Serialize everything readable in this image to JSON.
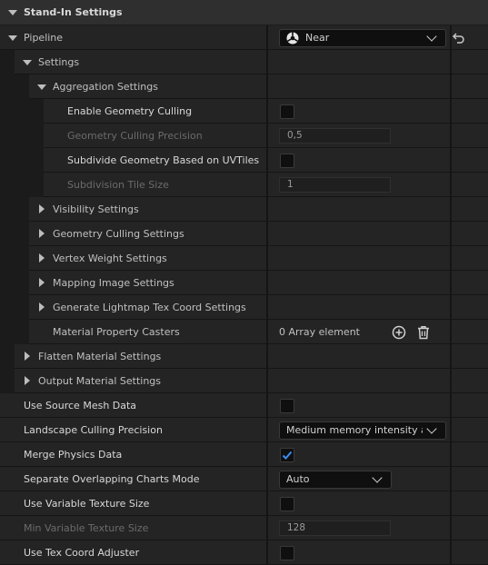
{
  "panel": {
    "title": "Stand-In Settings",
    "pipeline": {
      "label": "Pipeline",
      "value": "Near"
    },
    "settings_label": "Settings",
    "aggregation": {
      "label": "Aggregation Settings",
      "enable_geometry_culling": {
        "label": "Enable Geometry Culling",
        "checked": false
      },
      "geometry_culling_precision": {
        "label": "Geometry Culling Precision",
        "value": "0,5"
      },
      "subdivide_geometry": {
        "label": "Subdivide Geometry Based on UVTiles",
        "checked": false
      },
      "subdivision_tile_size": {
        "label": "Subdivision Tile Size",
        "value": "1"
      }
    },
    "collapsed_groups": [
      "Visibility Settings",
      "Geometry Culling Settings",
      "Vertex Weight Settings",
      "Mapping Image Settings",
      "Generate Lightmap Tex Coord Settings"
    ],
    "material_property_casters": {
      "label": "Material Property Casters",
      "value": "0 Array element"
    },
    "flatten_material": "Flatten Material Settings",
    "output_material": "Output Material Settings",
    "use_source_mesh_data": {
      "label": "Use Source Mesh Data",
      "checked": false
    },
    "landscape_culling_precision": {
      "label": "Landscape Culling Precision",
      "value": "Medium memory intensity and computation time"
    },
    "merge_physics_data": {
      "label": "Merge Physics Data",
      "checked": true
    },
    "separate_overlapping": {
      "label": "Separate Overlapping Charts Mode",
      "value": "Auto"
    },
    "use_variable_texture_size": {
      "label": "Use Variable Texture Size",
      "checked": false
    },
    "min_variable_texture_size": {
      "label": "Min Variable Texture Size",
      "value": "128"
    },
    "use_tex_coord_adjuster": {
      "label": "Use Tex Coord Adjuster",
      "checked": false
    }
  },
  "colors": {
    "accent": "#3b8ef0",
    "checkmark": "#3b8ef0"
  }
}
